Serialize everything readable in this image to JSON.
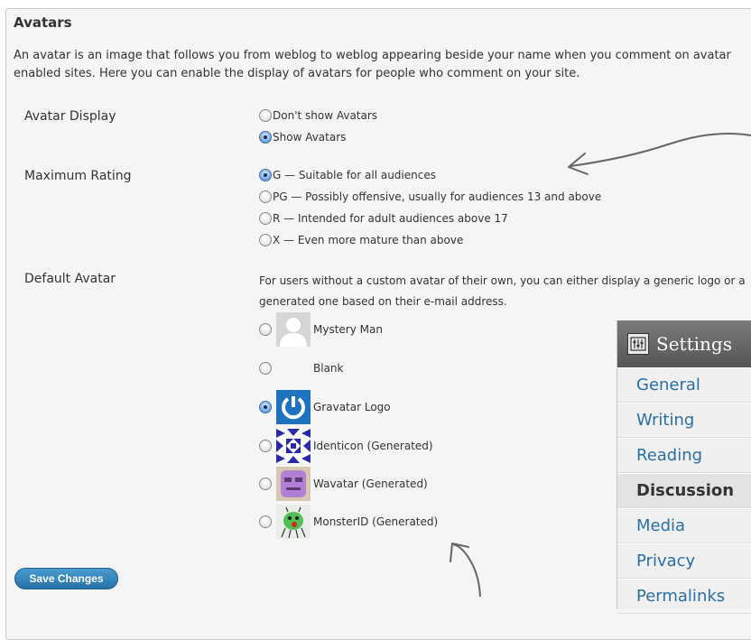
{
  "title": "Avatars",
  "description": "An avatar is an image that follows you from weblog to weblog appearing beside your name when you comment on avatar enabled sites. Here you can enable the display of avatars for people who comment on your site.",
  "avatar_display": {
    "label": "Avatar Display",
    "options": [
      {
        "label": "Don't show Avatars",
        "checked": false
      },
      {
        "label": "Show Avatars",
        "checked": true
      }
    ]
  },
  "max_rating": {
    "label": "Maximum Rating",
    "options": [
      {
        "label": "G — Suitable for all audiences",
        "checked": true
      },
      {
        "label": "PG — Possibly offensive, usually for audiences 13 and above",
        "checked": false
      },
      {
        "label": "R — Intended for adult audiences above 17",
        "checked": false
      },
      {
        "label": "X — Even more mature than above",
        "checked": false
      }
    ]
  },
  "default_avatar": {
    "label": "Default Avatar",
    "description": "For users without a custom avatar of their own, you can either display a generic logo or a generated one based on their e-mail address.",
    "options": [
      {
        "label": "Mystery Man",
        "icon": "mystery-man-avatar",
        "checked": false
      },
      {
        "label": "Blank",
        "icon": "blank-avatar",
        "checked": false
      },
      {
        "label": "Gravatar Logo",
        "icon": "gravatar-logo-avatar",
        "checked": true
      },
      {
        "label": "Identicon (Generated)",
        "icon": "identicon-avatar",
        "checked": false
      },
      {
        "label": "Wavatar (Generated)",
        "icon": "wavatar-avatar",
        "checked": false
      },
      {
        "label": "MonsterID (Generated)",
        "icon": "monsterid-avatar",
        "checked": false
      }
    ]
  },
  "save_button": "Save Changes",
  "settings_menu": {
    "heading": "Settings",
    "items": [
      {
        "label": "General",
        "active": false
      },
      {
        "label": "Writing",
        "active": false
      },
      {
        "label": "Reading",
        "active": false
      },
      {
        "label": "Discussion",
        "active": true
      },
      {
        "label": "Media",
        "active": false
      },
      {
        "label": "Privacy",
        "active": false
      },
      {
        "label": "Permalinks",
        "active": false
      }
    ]
  },
  "colors": {
    "link": "#2a6fa6",
    "button": "#2471a8",
    "annotation": "#666666"
  }
}
